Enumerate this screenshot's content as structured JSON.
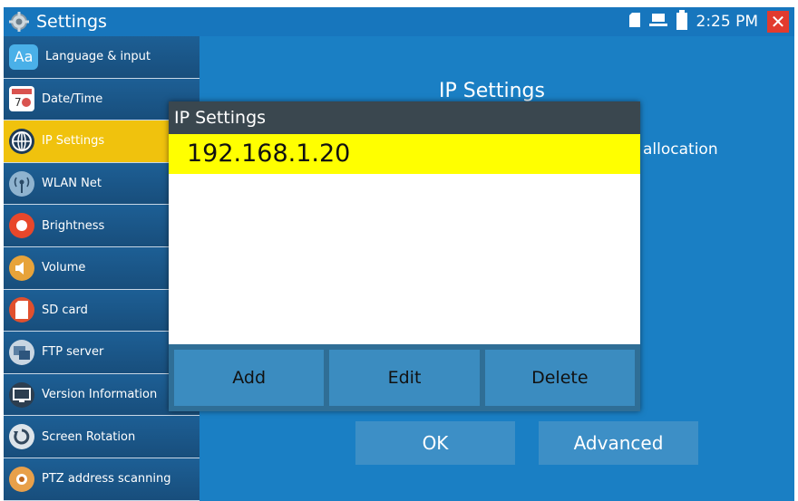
{
  "statusbar": {
    "title": "Settings",
    "clock": "2:25 PM",
    "icons": [
      "sd-card-icon",
      "network-icon",
      "battery-icon",
      "close-icon"
    ]
  },
  "sidebar": {
    "items": [
      {
        "label": "Language & input",
        "icon": "language-icon"
      },
      {
        "label": "Date/Time",
        "icon": "calendar-icon"
      },
      {
        "label": "IP Settings",
        "icon": "globe-icon",
        "active": true
      },
      {
        "label": "WLAN Net",
        "icon": "wifi-antenna-icon"
      },
      {
        "label": "Brightness",
        "icon": "brightness-icon"
      },
      {
        "label": "Volume",
        "icon": "speaker-icon"
      },
      {
        "label": "SD card",
        "icon": "sd-card-icon"
      },
      {
        "label": "FTP server",
        "icon": "ftp-server-icon"
      },
      {
        "label": "Version Information",
        "icon": "monitor-icon"
      },
      {
        "label": "Screen Rotation",
        "icon": "rotation-icon"
      },
      {
        "label": "PTZ address scanning",
        "icon": "ptz-camera-icon"
      }
    ]
  },
  "main": {
    "title": "IP Settings",
    "allocation_text": "allocation",
    "ok_label": "OK",
    "advanced_label": "Advanced"
  },
  "dialog": {
    "title": "IP Settings",
    "selected_ip": "192.168.1.20",
    "add_label": "Add",
    "edit_label": "Edit",
    "delete_label": "Delete"
  },
  "colors": {
    "background": "#1a7fc4",
    "active_item": "#f0c20d",
    "selection": "#ffff00",
    "dialog_title": "#3a474f"
  }
}
